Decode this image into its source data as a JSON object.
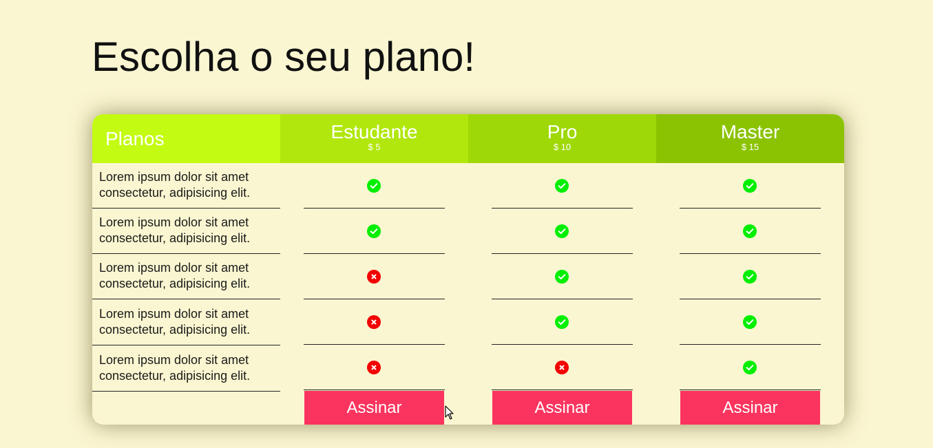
{
  "page": {
    "title": "Escolha o seu plano!"
  },
  "table": {
    "header_label": "Planos",
    "plans": [
      {
        "name": "Estudante",
        "price": "$ 5",
        "button": "Assinar"
      },
      {
        "name": "Pro",
        "price": "$ 10",
        "button": "Assinar"
      },
      {
        "name": "Master",
        "price": "$ 15",
        "button": "Assinar"
      }
    ],
    "features": [
      {
        "line1": "Lorem ipsum dolor sit amet",
        "line2": "consectetur, adipisicing elit.",
        "included": [
          true,
          true,
          true
        ]
      },
      {
        "line1": "Lorem ipsum dolor sit amet",
        "line2": "consectetur, adipisicing elit.",
        "included": [
          true,
          true,
          true
        ]
      },
      {
        "line1": "Lorem ipsum dolor sit amet",
        "line2": "consectetur, adipisicing elit.",
        "included": [
          false,
          true,
          true
        ]
      },
      {
        "line1": "Lorem ipsum dolor sit amet",
        "line2": "consectetur, adipisicing elit.",
        "included": [
          false,
          true,
          true
        ]
      },
      {
        "line1": "Lorem ipsum dolor sit amet",
        "line2": "consectetur, adipisicing elit.",
        "included": [
          false,
          false,
          true
        ]
      }
    ]
  },
  "icons": {
    "included": "check-circle-icon",
    "excluded": "x-circle-icon",
    "cursor": "mouse-pointer-icon"
  },
  "colors": {
    "background": "#faf6d1",
    "header_planos": "#c3fb12",
    "header_plans": [
      "#b1e70c",
      "#9fd807",
      "#8bc302"
    ],
    "check": "#00ef00",
    "cross": "#f30000",
    "button": "#fa345e"
  }
}
